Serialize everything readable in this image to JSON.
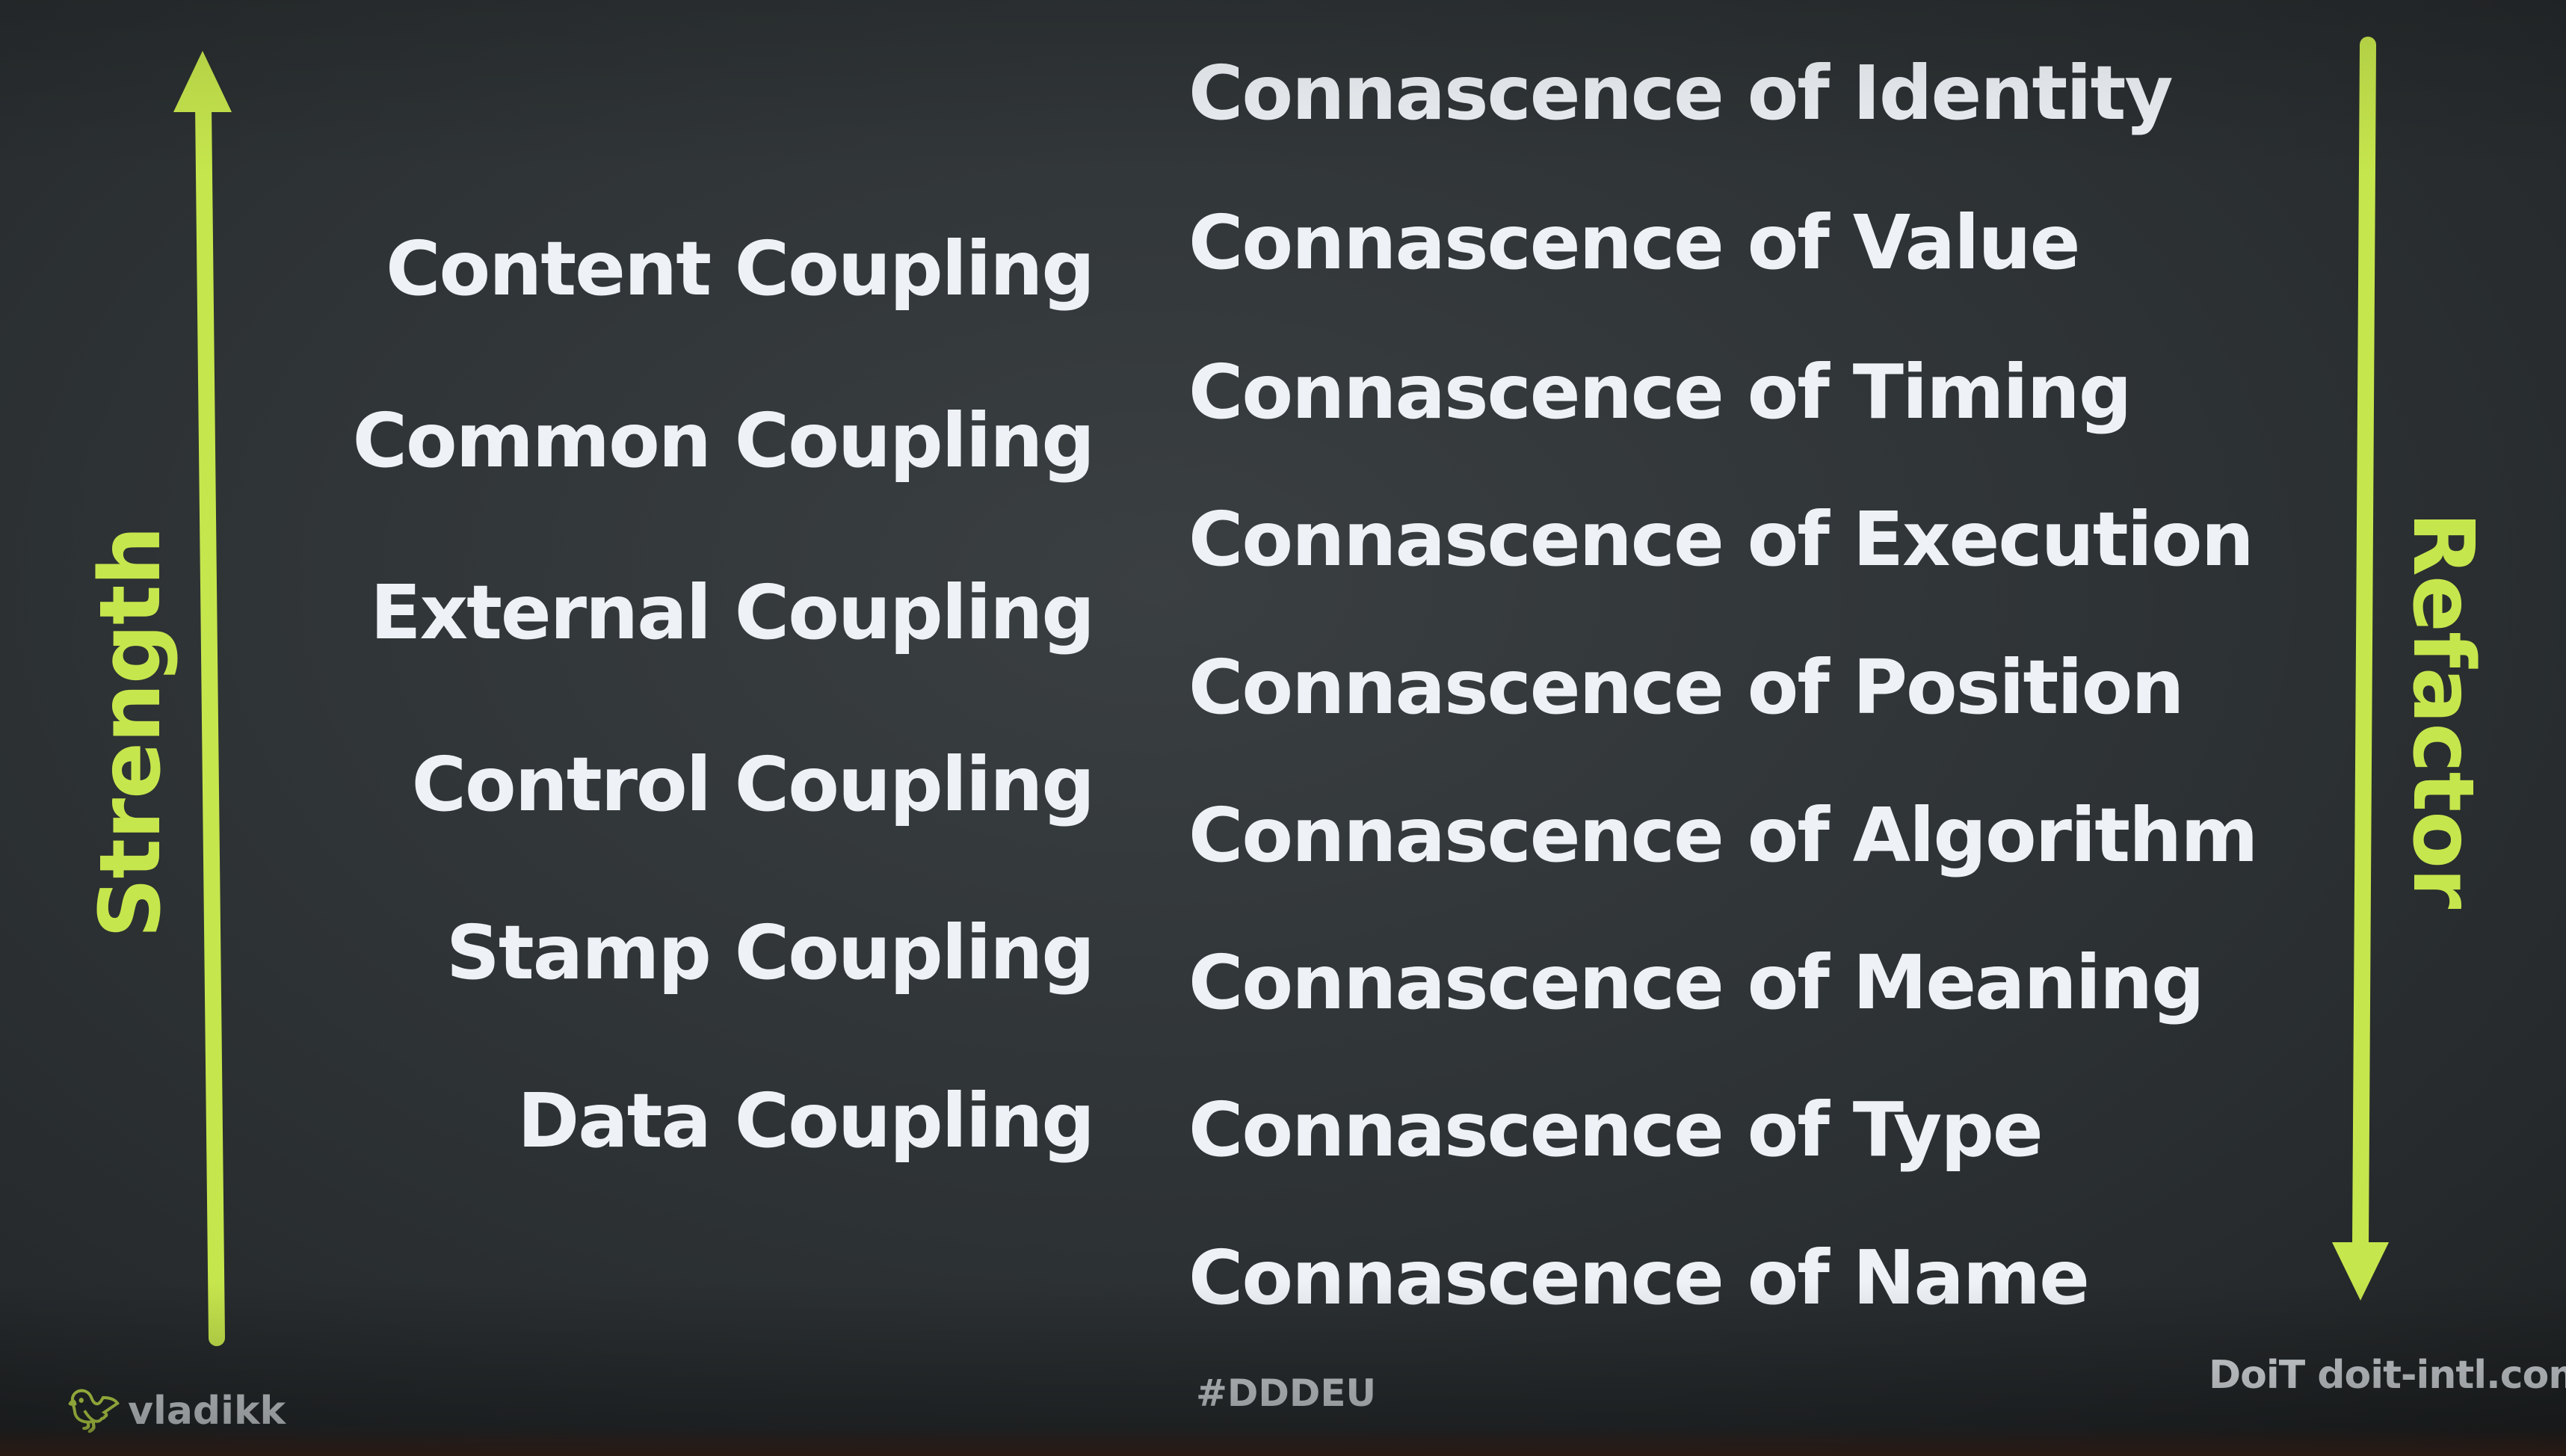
{
  "axes": {
    "left_label": "Strength",
    "right_label": "Refactor",
    "accent_color": "#c6e64d"
  },
  "coupling": [
    "Content Coupling",
    "Common Coupling",
    "External Coupling",
    "Control Coupling",
    "Stamp Coupling",
    "Data Coupling"
  ],
  "connascence": [
    "Connascence of Identity",
    "Connascence of Value",
    "Connascence of Timing",
    "Connascence of Execution",
    "Connascence of Position",
    "Connascence of Algorithm",
    "Connascence of Meaning",
    "Connascence of Type",
    "Connascence of Name"
  ],
  "footer": {
    "twitter_icon": "twitter-bird-icon",
    "handle": "vladikk",
    "hashtag": "#DDDEU",
    "logo_text": "DoiT",
    "site": "doit-intl.com"
  }
}
